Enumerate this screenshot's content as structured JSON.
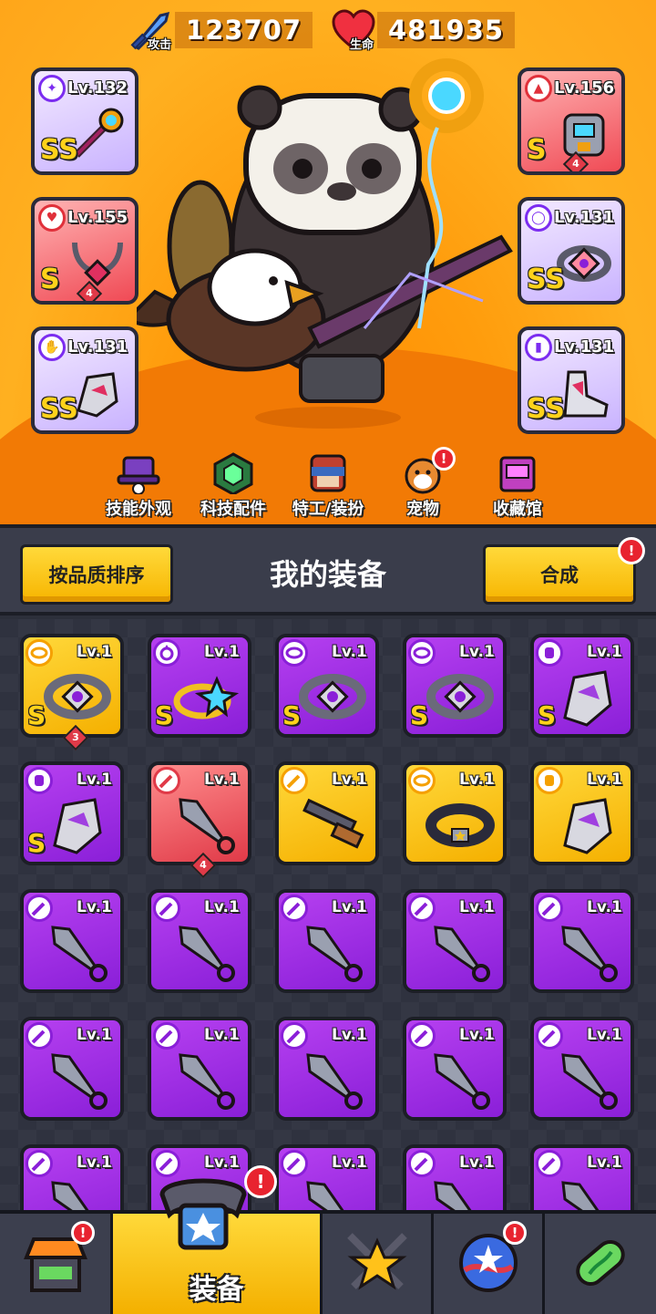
{
  "stats": {
    "attack": {
      "label": "攻击",
      "value": "123707"
    },
    "hp": {
      "label": "生命",
      "value": "481935"
    }
  },
  "equipped": {
    "left": [
      {
        "level": "Lv.132",
        "grade": "SS",
        "rarity": "purple",
        "slot": "weapon",
        "stars": ""
      },
      {
        "level": "Lv.155",
        "grade": "S",
        "rarity": "red",
        "slot": "necklace",
        "stars": "4"
      },
      {
        "level": "Lv.131",
        "grade": "SS",
        "rarity": "purple",
        "slot": "gloves",
        "stars": ""
      }
    ],
    "right": [
      {
        "level": "Lv.156",
        "grade": "S",
        "rarity": "red",
        "slot": "armor",
        "stars": "4"
      },
      {
        "level": "Lv.131",
        "grade": "SS",
        "rarity": "purple",
        "slot": "belt",
        "stars": ""
      },
      {
        "level": "Lv.131",
        "grade": "SS",
        "rarity": "purple",
        "slot": "boots",
        "stars": ""
      }
    ]
  },
  "menu": [
    {
      "label": "技能外观",
      "icon": "hat-icon",
      "alert": false
    },
    {
      "label": "科技配件",
      "icon": "tech-chip-icon",
      "alert": false
    },
    {
      "label": "特工/装扮",
      "icon": "agent-icon",
      "alert": false
    },
    {
      "label": "宠物",
      "icon": "pet-dog-icon",
      "alert": true
    },
    {
      "label": "收藏馆",
      "icon": "collection-chest-icon",
      "alert": false
    }
  ],
  "equipment_header": {
    "sort_label": "按品质排序",
    "title": "我的装备",
    "synthesize_label": "合成",
    "synthesize_alert": "!"
  },
  "inventory": [
    {
      "level": "Lv.1",
      "rarity": "gold",
      "grade": "S",
      "item": "belt",
      "stars": "3"
    },
    {
      "level": "Lv.1",
      "rarity": "purple",
      "grade": "S",
      "item": "ring",
      "stars": ""
    },
    {
      "level": "Lv.1",
      "rarity": "purple",
      "grade": "S",
      "item": "belt",
      "stars": ""
    },
    {
      "level": "Lv.1",
      "rarity": "purple",
      "grade": "S",
      "item": "belt",
      "stars": ""
    },
    {
      "level": "Lv.1",
      "rarity": "purple",
      "grade": "S",
      "item": "gauntlet",
      "stars": ""
    },
    {
      "level": "Lv.1",
      "rarity": "purple",
      "grade": "S",
      "item": "gauntlet",
      "stars": ""
    },
    {
      "level": "Lv.1",
      "rarity": "red",
      "grade": "",
      "item": "kunai",
      "stars": "4"
    },
    {
      "level": "Lv.1",
      "rarity": "gold",
      "grade": "",
      "item": "shotgun",
      "stars": ""
    },
    {
      "level": "Lv.1",
      "rarity": "gold",
      "grade": "",
      "item": "collar",
      "stars": ""
    },
    {
      "level": "Lv.1",
      "rarity": "gold",
      "grade": "",
      "item": "gauntlet",
      "stars": ""
    },
    {
      "level": "Lv.1",
      "rarity": "purple",
      "grade": "",
      "item": "kunai",
      "stars": ""
    },
    {
      "level": "Lv.1",
      "rarity": "purple",
      "grade": "",
      "item": "kunai",
      "stars": ""
    },
    {
      "level": "Lv.1",
      "rarity": "purple",
      "grade": "",
      "item": "kunai",
      "stars": ""
    },
    {
      "level": "Lv.1",
      "rarity": "purple",
      "grade": "",
      "item": "kunai",
      "stars": ""
    },
    {
      "level": "Lv.1",
      "rarity": "purple",
      "grade": "",
      "item": "kunai",
      "stars": ""
    },
    {
      "level": "Lv.1",
      "rarity": "purple",
      "grade": "",
      "item": "kunai",
      "stars": ""
    },
    {
      "level": "Lv.1",
      "rarity": "purple",
      "grade": "",
      "item": "kunai",
      "stars": ""
    },
    {
      "level": "Lv.1",
      "rarity": "purple",
      "grade": "",
      "item": "kunai",
      "stars": ""
    },
    {
      "level": "Lv.1",
      "rarity": "purple",
      "grade": "",
      "item": "kunai",
      "stars": ""
    },
    {
      "level": "Lv.1",
      "rarity": "purple",
      "grade": "",
      "item": "kunai",
      "stars": ""
    },
    {
      "level": "Lv.1",
      "rarity": "purple",
      "grade": "",
      "item": "kunai",
      "stars": ""
    },
    {
      "level": "Lv.1",
      "rarity": "purple",
      "grade": "",
      "item": "kunai",
      "stars": ""
    },
    {
      "level": "Lv.1",
      "rarity": "purple",
      "grade": "",
      "item": "kunai",
      "stars": ""
    },
    {
      "level": "Lv.1",
      "rarity": "purple",
      "grade": "",
      "item": "kunai",
      "stars": ""
    },
    {
      "level": "Lv.1",
      "rarity": "purple",
      "grade": "",
      "item": "kunai",
      "stars": ""
    }
  ],
  "nav": {
    "tabs": [
      {
        "name": "shop",
        "icon": "shop-stall-icon",
        "label": "",
        "alert": true,
        "active": false
      },
      {
        "name": "equipment",
        "icon": "equipment-belt-icon",
        "label": "装备",
        "alert": true,
        "active": true
      },
      {
        "name": "battle",
        "icon": "crossed-swords-star-icon",
        "label": "",
        "alert": false,
        "active": false
      },
      {
        "name": "galaxy",
        "icon": "star-planet-icon",
        "label": "",
        "alert": true,
        "active": false
      },
      {
        "name": "research",
        "icon": "dna-capsule-icon",
        "label": "",
        "alert": false,
        "active": false
      }
    ],
    "alert_mark": "!"
  },
  "colors": {
    "purple": "#9a2ee0",
    "gold": "#f7b500",
    "red": "#e03a48",
    "orange_bg": "#ff9d0d"
  }
}
